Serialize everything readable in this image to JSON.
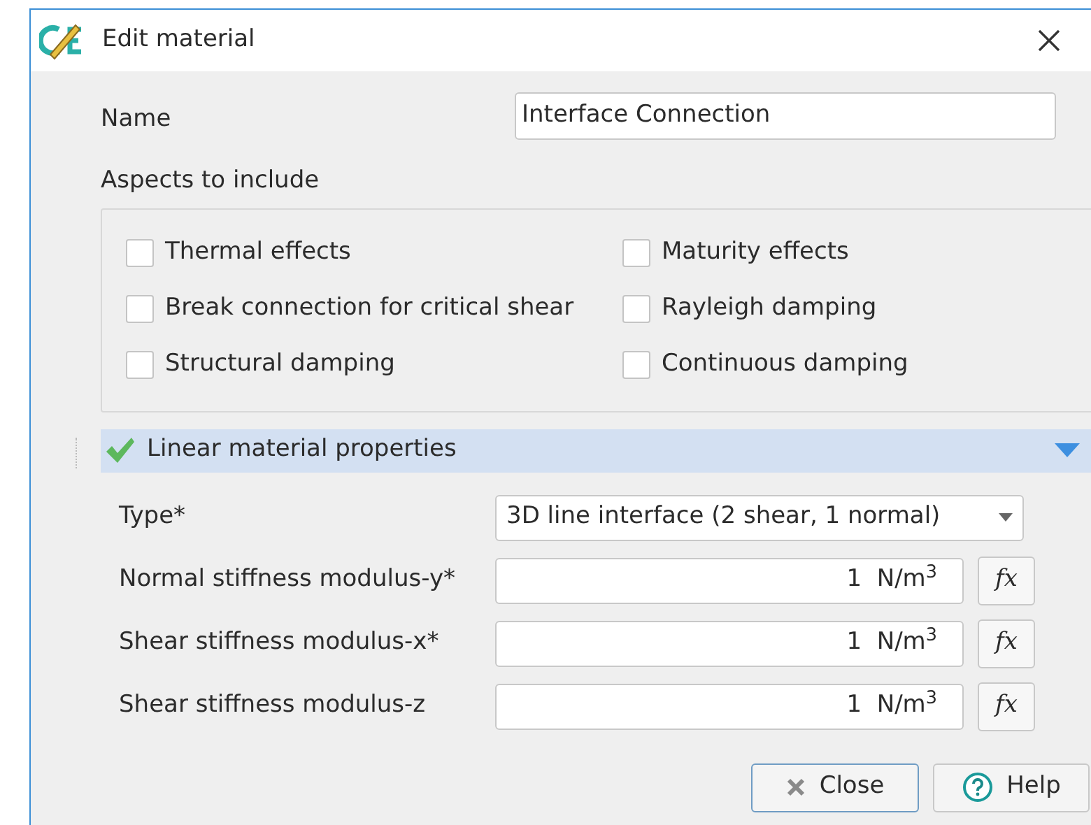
{
  "window": {
    "title": "Edit material"
  },
  "name_field": {
    "label": "Name",
    "value": "Interface Connection"
  },
  "aspects": {
    "label": "Aspects to include",
    "options": [
      {
        "label": "Thermal effects",
        "checked": false
      },
      {
        "label": "Maturity effects",
        "checked": false
      },
      {
        "label": "Break connection for critical shear",
        "checked": false
      },
      {
        "label": "Rayleigh damping",
        "checked": false
      },
      {
        "label": "Structural damping",
        "checked": false
      },
      {
        "label": "Continuous damping",
        "checked": false
      }
    ]
  },
  "section": {
    "title": "Linear material properties",
    "expanded": true,
    "valid": true,
    "fields": [
      {
        "kind": "dropdown",
        "label": "Type*",
        "value": "3D line interface (2 shear, 1 normal)"
      },
      {
        "kind": "number",
        "label": "Normal stiffness modulus-y*",
        "value": "1  N/m$^{3}$",
        "button": "fx"
      },
      {
        "kind": "number",
        "label": "Shear stiffness modulus-x*",
        "value": "1  N/m$^{3}$",
        "button": "fx"
      },
      {
        "kind": "number",
        "label": "Shear stiffness modulus-z",
        "value": "1  N/m$^{3}$",
        "button": "fx"
      }
    ]
  },
  "buttons": [
    {
      "label": "Close",
      "kind": "close"
    },
    {
      "label": "Help",
      "kind": "help"
    }
  ]
}
